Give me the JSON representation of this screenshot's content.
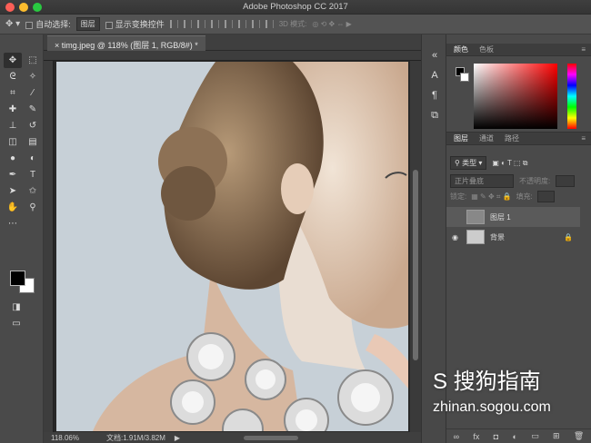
{
  "window": {
    "title": "Adobe Photoshop CC 2017"
  },
  "options": {
    "auto_select_label": "自动选择:",
    "auto_select_value": "图层",
    "show_transform_label": "显示变换控件",
    "mode_3d_label": "3D 模式:"
  },
  "document": {
    "tab_label": "timg.jpeg @ 118% (图层 1, RGB/8#) *"
  },
  "status": {
    "zoom": "118.06%",
    "doc_info": "文档:1.91M/3.82M"
  },
  "color_panel": {
    "tab_color": "颜色",
    "tab_swatches": "色板"
  },
  "layers_panel": {
    "tabs": [
      "图层",
      "通道",
      "路径"
    ],
    "filter_kind": "类型",
    "blend_mode": "正片叠底",
    "opacity_label": "不透明度:",
    "lock_label": "锁定:",
    "fill_label": "填充:",
    "layers": [
      {
        "name": "图层 1"
      },
      {
        "name": "背景"
      }
    ]
  },
  "watermark": {
    "brand": "S 搜狗指南",
    "url": "zhinan.sogou.com"
  },
  "colors": {
    "foreground": "#000000",
    "background": "#ffffff",
    "selected_layer": "#5a5a5a"
  }
}
